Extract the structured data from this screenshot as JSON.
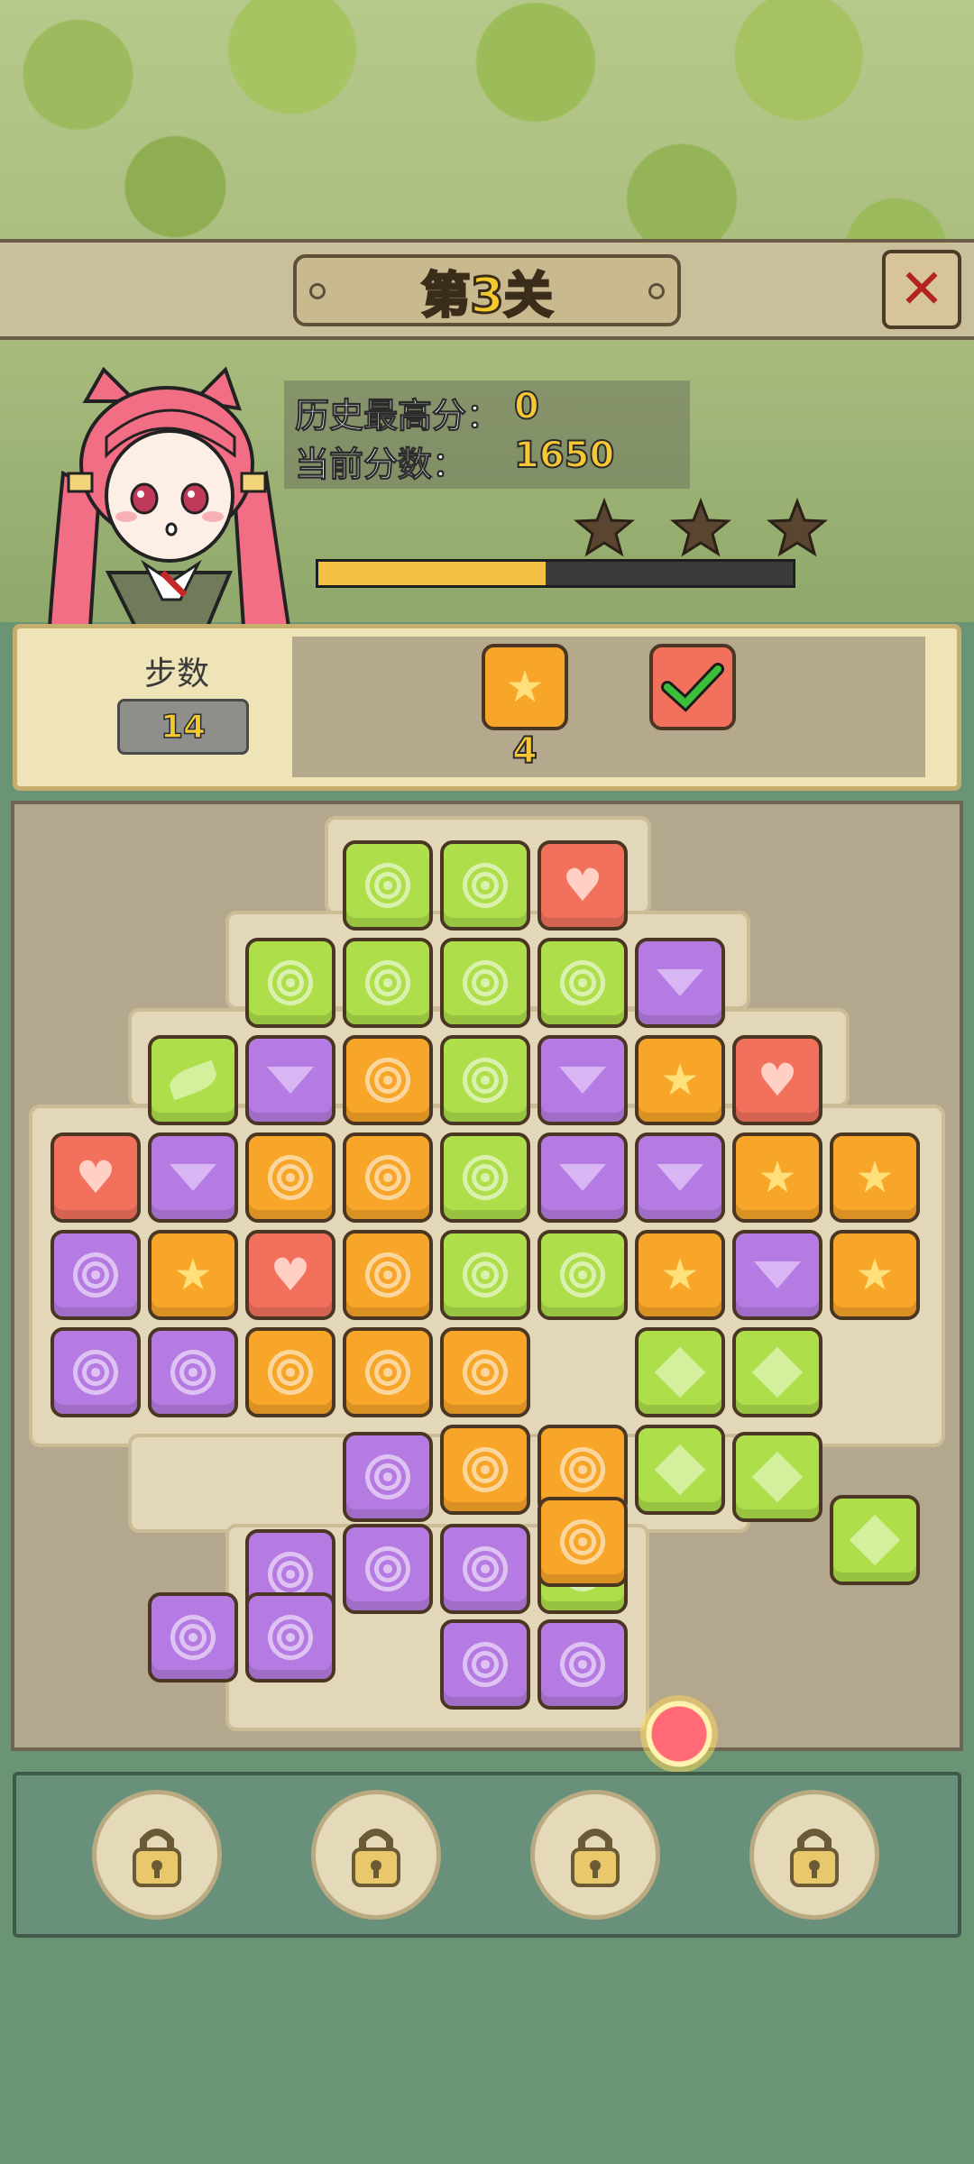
{
  "header": {
    "level_title": "第3关",
    "close_label": "✕"
  },
  "score": {
    "best_label": "历史最高分：",
    "best_value": "0",
    "current_label": "当前分数：",
    "current_value": "1650",
    "stars_earned": 0,
    "stars_total": 3,
    "progress_fraction": 0.48
  },
  "moves": {
    "label": "步数",
    "value": "14"
  },
  "goals": [
    {
      "icon": "star-tile-icon",
      "count": "4"
    },
    {
      "icon": "completed-check-icon",
      "count": ""
    }
  ],
  "colors": {
    "green": "#aede4a",
    "red": "#f2715d",
    "purple": "#b67be2",
    "orange": "#f7a629",
    "progress": "#f4c043"
  },
  "tools": [
    {
      "name": "hammer-lock-icon"
    },
    {
      "name": "swap-lock-icon"
    },
    {
      "name": "lock-icon"
    },
    {
      "name": "box-lock-icon"
    }
  ],
  "board": {
    "rows": [
      [
        "",
        "",
        "",
        "green-swirl",
        "green-swirl",
        "red-heart",
        "",
        "",
        "",
        ""
      ],
      [
        "",
        "",
        "green-swirl",
        "green-swirl",
        "green-swirl",
        "green-swirl",
        "purple-gem",
        "",
        "",
        ""
      ],
      [
        "",
        "green-leaf",
        "purple-gem",
        "orange-swirl",
        "green-swirl",
        "purple-gem",
        "orange-star",
        "red-heart",
        "",
        ""
      ],
      [
        "red-heart",
        "purple-gem",
        "orange-swirl",
        "orange-swirl",
        "green-swirl",
        "purple-gem",
        "purple-gem",
        "orange-star",
        "orange-star",
        ""
      ],
      [
        "purple-swirl",
        "orange-star",
        "red-heart",
        "orange-swirl",
        "green-swirl",
        "green-swirl",
        "orange-star",
        "purple-gem",
        "orange-star",
        ""
      ],
      [
        "purple-swirl",
        "purple-swirl",
        "orange-swirl",
        "orange-swirl",
        "orange-swirl",
        "",
        "green-diamond",
        "green-diamond",
        "",
        ""
      ]
    ]
  }
}
